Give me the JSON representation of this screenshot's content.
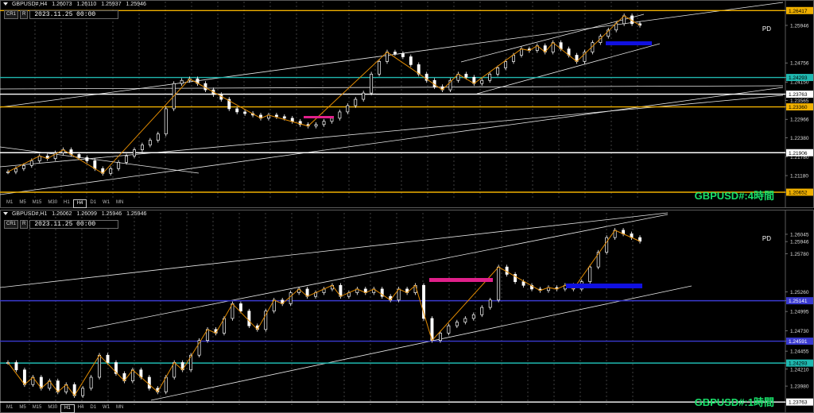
{
  "chart_data": [
    {
      "type": "candlestick",
      "symbol_header": [
        "GBPUSD#,H4",
        "1.26073",
        "1.26110",
        "1.25937",
        "1.25946"
      ],
      "chart_label": "GBPUSD#:4時間",
      "indicator_label": "PD",
      "date_field": "2023.11.25 00:00",
      "ylim": [
        1.204,
        1.265
      ],
      "y_ticks": [
        "1.26417",
        "1.25946",
        "1.24756",
        "1.24293",
        "1.24150",
        "1.23763",
        "1.23565",
        "1.23360",
        "1.22966",
        "1.22380",
        "1.21906",
        "1.21780",
        "1.21180",
        "1.20652"
      ],
      "close_path": [
        1.213,
        1.214,
        1.215,
        1.2165,
        1.218,
        1.2172,
        1.219,
        1.22,
        1.2185,
        1.2175,
        1.2165,
        1.214,
        1.2125,
        1.214,
        1.216,
        1.218,
        1.22,
        1.2215,
        1.223,
        1.225,
        1.233,
        1.241,
        1.242,
        1.2425,
        1.241,
        1.239,
        1.2375,
        1.236,
        1.233,
        1.232,
        1.2315,
        1.231,
        1.23,
        1.231,
        1.2305,
        1.23,
        1.229,
        1.228,
        1.2275,
        1.228,
        1.229,
        1.23,
        1.232,
        1.234,
        1.236,
        1.238,
        1.244,
        1.248,
        1.251,
        1.2505,
        1.2495,
        1.247,
        1.244,
        1.242,
        1.24,
        1.239,
        1.242,
        1.244,
        1.243,
        1.241,
        1.242,
        1.244,
        1.246,
        1.248,
        1.25,
        1.252,
        1.2515,
        1.253,
        1.251,
        1.254,
        1.252,
        1.25,
        1.248,
        1.251,
        1.254,
        1.256,
        1.258,
        1.26,
        1.2625,
        1.26,
        1.2595
      ],
      "horizontal_lines": [
        {
          "value": 1.26417,
          "label": "1.26417",
          "color": "#f0b000"
        },
        {
          "value": 1.24293,
          "label": "1.24293",
          "color": "#1fb8b0"
        },
        {
          "value": 1.23763,
          "label": "1.23763",
          "color": "#ffffff"
        },
        {
          "value": 1.2336,
          "label": "1.23360",
          "color": "#f0b000"
        },
        {
          "value": 1.21906,
          "label": "1.21906",
          "color": "#ffffff"
        },
        {
          "value": 1.20652,
          "label": "1.20652",
          "color": "#f0b000"
        }
      ],
      "timeframes": [
        "M1",
        "M5",
        "M15",
        "M30",
        "H1",
        "H4",
        "D1",
        "W1",
        "MN"
      ],
      "active_timeframe": "H4"
    },
    {
      "type": "candlestick",
      "symbol_header": [
        "GBPUSD#,H1",
        "1.26062",
        "1.26099",
        "1.25946",
        "1.25946"
      ],
      "chart_label": "GBPUSD#:1時間",
      "indicator_label": "PD",
      "date_field": "2023.11.25 00:00",
      "ylim": [
        1.237,
        1.2625
      ],
      "y_ticks": [
        "1.26045",
        "1.25946",
        "1.25780",
        "1.25260",
        "1.25141",
        "1.24995",
        "1.24730",
        "1.24591",
        "1.24455",
        "1.24293",
        "1.24210",
        "1.23980",
        "1.23763"
      ],
      "close_path": [
        1.243,
        1.242,
        1.24,
        1.241,
        1.2395,
        1.2405,
        1.239,
        1.24,
        1.2385,
        1.2395,
        1.241,
        1.244,
        1.243,
        1.2415,
        1.2405,
        1.242,
        1.241,
        1.2395,
        1.239,
        1.241,
        1.243,
        1.242,
        1.244,
        1.246,
        1.2475,
        1.247,
        1.249,
        1.251,
        1.25,
        1.248,
        1.2475,
        1.25,
        1.2515,
        1.251,
        1.2525,
        1.253,
        1.252,
        1.2525,
        1.253,
        1.2535,
        1.252,
        1.2525,
        1.253,
        1.2525,
        1.253,
        1.252,
        1.2515,
        1.253,
        1.2525,
        1.2535,
        1.249,
        1.246,
        1.247,
        1.248,
        1.2485,
        1.249,
        1.2495,
        1.2505,
        1.2515,
        1.256,
        1.255,
        1.254,
        1.2535,
        1.253,
        1.2528,
        1.2532,
        1.253,
        1.2535,
        1.253,
        1.254,
        1.256,
        1.258,
        1.26,
        1.261,
        1.2605,
        1.26,
        1.2595
      ],
      "horizontal_lines": [
        {
          "value": 1.25141,
          "label": "1.25141",
          "color": "#3a3ad0"
        },
        {
          "value": 1.24591,
          "label": "1.24591",
          "color": "#3a3ad0"
        },
        {
          "value": 1.24293,
          "label": "1.24293",
          "color": "#1fb8b0"
        },
        {
          "value": 1.23763,
          "label": "1.23763",
          "color": "#ffffff"
        }
      ],
      "timeframes": [
        "M1",
        "M5",
        "M15",
        "M30",
        "H1",
        "H4",
        "D1",
        "W1",
        "MN"
      ],
      "active_timeframe": "H1"
    }
  ],
  "colors": {
    "up": "#ffffff",
    "down": "#ffffff",
    "wick": "#ffffff",
    "zigzag": "#e08a00",
    "grid": "#6a6a6a",
    "label_green": "#19e06a"
  },
  "ui": {
    "cr_button": "CR1",
    "r_button": "R"
  }
}
